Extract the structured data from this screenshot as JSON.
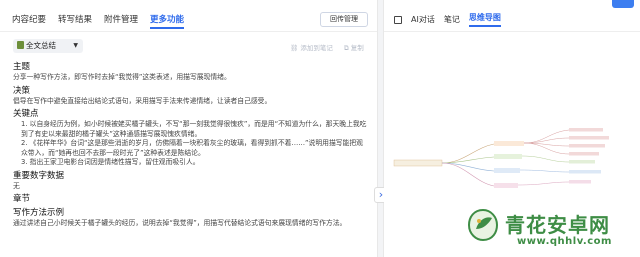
{
  "left": {
    "tabs": [
      "内容纪要",
      "转写结果",
      "附件管理",
      "更多功能"
    ],
    "active_tab": 3,
    "upload_label": "回传管理",
    "summary_dropdown": "全文总结",
    "add_notes": "添加到笔记",
    "copy": "复制",
    "sections": {
      "theme_h": "主题",
      "theme_p": "分享一种写作方法，即写作时去掉“我觉得”这类表述，用描写展现情绪。",
      "decision_h": "决策",
      "decision_p": "倡导在写作中避免直接给出结论式语句，采用描写手法来传递情绪，让读者自己感受。",
      "keypoints_h": "关键点",
      "kp1": "1. 以自身经历为例，如小时候被姥买橘子罐头，不写“那一刻我觉得很愧疚”，而是用“不知道为什么，那天晚上我吃到了有史以来最甜的橘子罐头”这种通感描写展现愧疚情绪。",
      "kp2": "2. 《花样年华》台词“这是那些消逝的岁月，仿佛隔着一块积着灰尘的玻璃，看得到抓不着……”说明用描写能把观众带入，而“她再也回不去那一段时光了”这种表述是陈结论。",
      "kp3": "3. 指出王家卫电影台词因是情绪性描写，留住观而吸引人。",
      "numbers_h": "重要数字数据",
      "numbers_p": "无",
      "chapter_h": "章节",
      "examples_h": "写作方法示例",
      "examples_p": "通过讲述自己小时候关于橘子罐头的经历，说明去掉“我觉得”，用描写代替结论式语句来展现情绪的写作方法。"
    }
  },
  "right": {
    "tabs": [
      "AI对话",
      "笔记",
      "思维导图"
    ],
    "active_tab": 2
  },
  "watermark": {
    "title": "青花安卓网",
    "url": "www.qhhlv.com"
  },
  "colors": {
    "accent": "#2f6bec",
    "watermark_green": "#3e8d45"
  }
}
